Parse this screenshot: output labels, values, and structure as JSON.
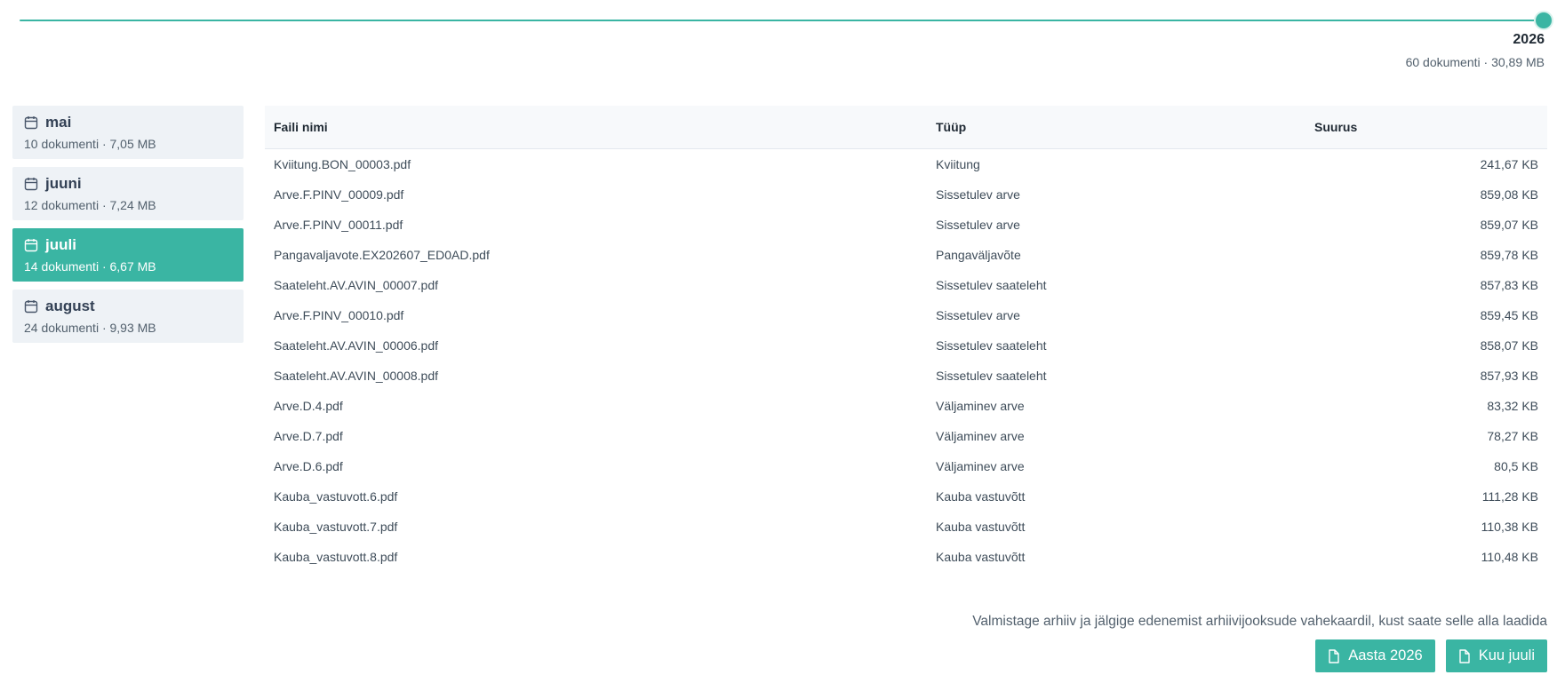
{
  "year_slider": {
    "value": 2026,
    "position_fraction": 1.0,
    "label": "2026",
    "summary": "60 dokumenti · 30,89 MB"
  },
  "months": [
    {
      "name": "mai",
      "meta": "10 dokumenti · 7,05 MB",
      "active": false
    },
    {
      "name": "juuni",
      "meta": "12 dokumenti · 7,24 MB",
      "active": false
    },
    {
      "name": "juuli",
      "meta": "14 dokumenti · 6,67 MB",
      "active": true
    },
    {
      "name": "august",
      "meta": "24 dokumenti · 9,93 MB",
      "active": false
    }
  ],
  "table": {
    "headers": {
      "name": "Faili nimi",
      "type": "Tüüp",
      "size": "Suurus"
    },
    "rows": [
      {
        "name": "Kviitung.BON_00003.pdf",
        "type": "Kviitung",
        "size": "241,67 KB"
      },
      {
        "name": "Arve.F.PINV_00009.pdf",
        "type": "Sissetulev arve",
        "size": "859,08 KB"
      },
      {
        "name": "Arve.F.PINV_00011.pdf",
        "type": "Sissetulev arve",
        "size": "859,07 KB"
      },
      {
        "name": "Pangavaljavote.EX202607_ED0AD.pdf",
        "type": "Pangaväljavõte",
        "size": "859,78 KB"
      },
      {
        "name": "Saateleht.AV.AVIN_00007.pdf",
        "type": "Sissetulev saateleht",
        "size": "857,83 KB"
      },
      {
        "name": "Arve.F.PINV_00010.pdf",
        "type": "Sissetulev arve",
        "size": "859,45 KB"
      },
      {
        "name": "Saateleht.AV.AVIN_00006.pdf",
        "type": "Sissetulev saateleht",
        "size": "858,07 KB"
      },
      {
        "name": "Saateleht.AV.AVIN_00008.pdf",
        "type": "Sissetulev saateleht",
        "size": "857,93 KB"
      },
      {
        "name": "Arve.D.4.pdf",
        "type": "Väljaminev arve",
        "size": "83,32 KB"
      },
      {
        "name": "Arve.D.7.pdf",
        "type": "Väljaminev arve",
        "size": "78,27 KB"
      },
      {
        "name": "Arve.D.6.pdf",
        "type": "Väljaminev arve",
        "size": "80,5 KB"
      },
      {
        "name": "Kauba_vastuvott.6.pdf",
        "type": "Kauba vastuvõtt",
        "size": "111,28 KB"
      },
      {
        "name": "Kauba_vastuvott.7.pdf",
        "type": "Kauba vastuvõtt",
        "size": "110,38 KB"
      },
      {
        "name": "Kauba_vastuvott.8.pdf",
        "type": "Kauba vastuvõtt",
        "size": "110,48 KB"
      }
    ]
  },
  "footer": {
    "note": "Valmistage arhiiv ja jälgige edenemist arhiivijooksude vahekaardil, kust saate selle alla laadida",
    "year_button": "Aasta 2026",
    "month_button": "Kuu juuli"
  },
  "colors": {
    "accent": "#3ab5a3",
    "month_bg": "#eef2f6",
    "header_bg": "#f7f9fb"
  },
  "icons": {
    "month": "calendar-icon",
    "button": "document-icon",
    "slider_thumb": "circle"
  }
}
